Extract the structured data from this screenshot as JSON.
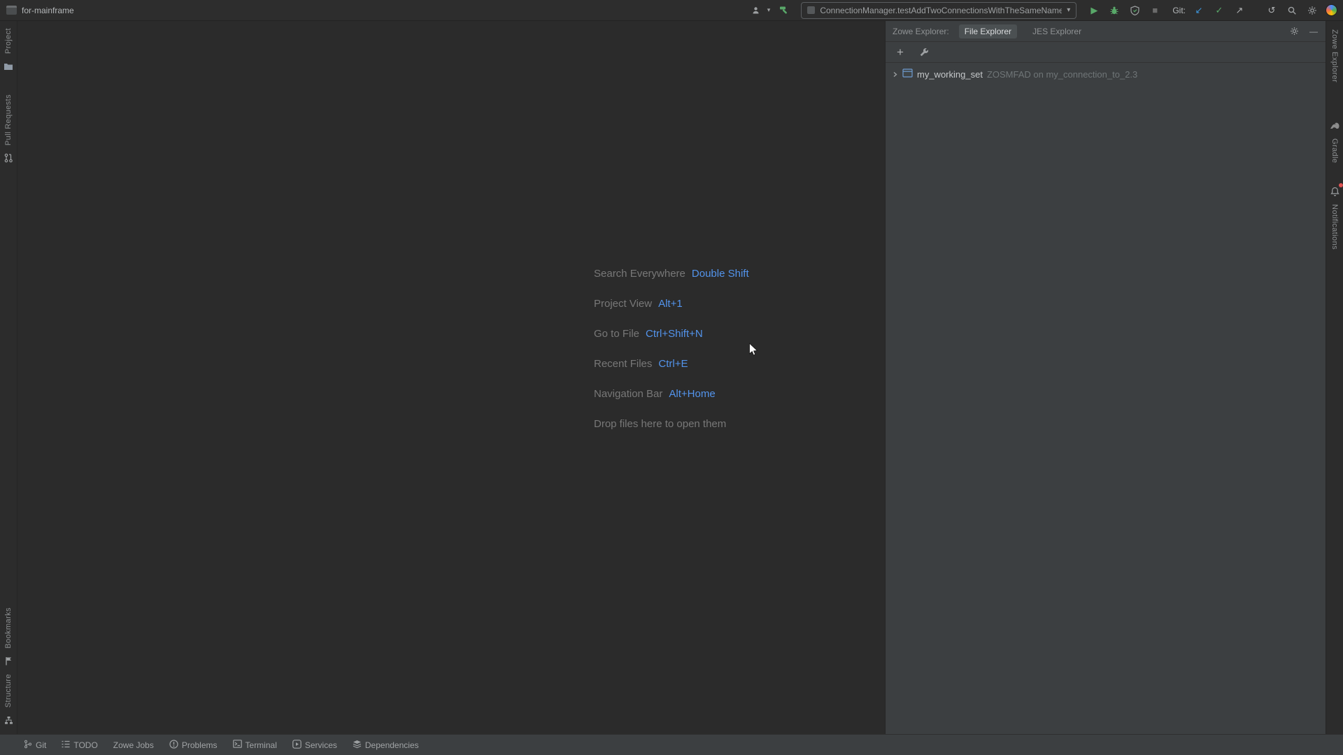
{
  "titlebar": {
    "project_name": "for-mainframe",
    "run_config": "ConnectionManager.testAddTwoConnectionsWithTheSameName",
    "git_label": "Git:"
  },
  "left_stripe": {
    "project": "Project",
    "pull_requests": "Pull Requests",
    "bookmarks": "Bookmarks",
    "structure": "Structure"
  },
  "right_stripe": {
    "zowe_explorer": "Zowe Explorer",
    "gradle": "Gradle",
    "notifications": "Notifications"
  },
  "editor": {
    "hints": [
      {
        "label": "Search Everywhere",
        "shortcut": "Double Shift"
      },
      {
        "label": "Project View",
        "shortcut": "Alt+1"
      },
      {
        "label": "Go to File",
        "shortcut": "Ctrl+Shift+N"
      },
      {
        "label": "Recent Files",
        "shortcut": "Ctrl+E"
      },
      {
        "label": "Navigation Bar",
        "shortcut": "Alt+Home"
      },
      {
        "label": "Drop files here to open them",
        "shortcut": ""
      }
    ]
  },
  "zowe_panel": {
    "title": "Zowe Explorer:",
    "tabs": [
      {
        "label": "File Explorer",
        "active": true
      },
      {
        "label": "JES Explorer",
        "active": false
      }
    ],
    "toolbar": {
      "add_label": "+"
    },
    "tree_item": {
      "name": "my_working_set",
      "detail": "ZOSMFAD on my_connection_to_2.3"
    },
    "hide_glyph": "—"
  },
  "statusbar": {
    "items": [
      "Git",
      "TODO",
      "Zowe Jobs",
      "Problems",
      "Terminal",
      "Services",
      "Dependencies"
    ]
  },
  "glyphs": {
    "play": "▶",
    "stop": "■",
    "caret": "▾",
    "commit_check": "✓",
    "update_arrow": "↙",
    "push_arrow": "↗",
    "rollback_arrow": "↺"
  },
  "colors": {
    "shortcut_blue": "#5394ec",
    "run_green": "#59a869",
    "update_blue": "#3d94d9",
    "notification_red": "#e05555",
    "panel_bg": "#3c3f41",
    "editor_bg": "#2b2b2b"
  }
}
